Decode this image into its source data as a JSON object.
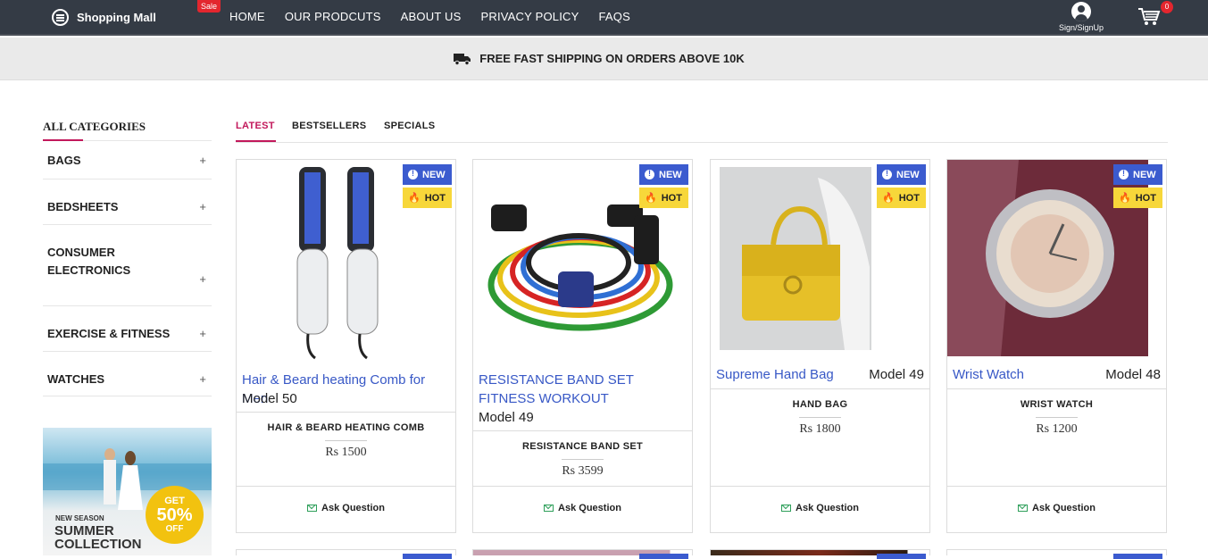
{
  "header": {
    "brand": "Shopping Mall",
    "sale_badge": "Sale",
    "nav": [
      "HOME",
      "OUR PRODCUTS",
      "ABOUT US",
      "PRIVACY POLICY",
      "FAQS"
    ],
    "account_label": "Sign/SignUp",
    "cart_count": "0"
  },
  "shipping_banner": "FREE FAST SHIPPING ON ORDERS ABOVE 10K",
  "sidebar": {
    "title": "ALL CATEGORIES",
    "categories": [
      "BAGS",
      "BEDSHEETS",
      "CONSUMER ELECTRONICS",
      "EXERCISE & FITNESS",
      "WATCHES"
    ],
    "expand_symbol": "+"
  },
  "promo": {
    "season": "NEW SEASON",
    "collection_line1": "SUMMER",
    "collection_line2": "COLLECTION",
    "get": "GET",
    "percent": "50%",
    "off": "OFF"
  },
  "tabs": [
    "LATEST",
    "BESTSELLERS",
    "SPECIALS"
  ],
  "badges": {
    "new": "NEW",
    "hot": "HOT"
  },
  "ask_label": "Ask Question",
  "products": [
    {
      "name": "Hair & Beard heating Comb for Men",
      "model": "Model 50",
      "subtitle": "HAIR & BEARD HEATING COMB",
      "price": "Rs 1500"
    },
    {
      "name": "RESISTANCE BAND SET FITNESS WORKOUT",
      "model": "Model 49",
      "subtitle": "RESISTANCE BAND SET",
      "price": "Rs 3599"
    },
    {
      "name": "Supreme Hand Bag",
      "model": "Model 49",
      "subtitle": "HAND BAG",
      "price": "Rs 1800"
    },
    {
      "name": "Wrist Watch",
      "model": "Model 48",
      "subtitle": "WRIST WATCH",
      "price": "Rs 1200"
    }
  ],
  "colors": {
    "accent": "#c2185b",
    "topbar": "#343b45",
    "new_badge": "#3b5bcf",
    "hot_badge": "#f7d73a",
    "link": "#3858c6"
  }
}
